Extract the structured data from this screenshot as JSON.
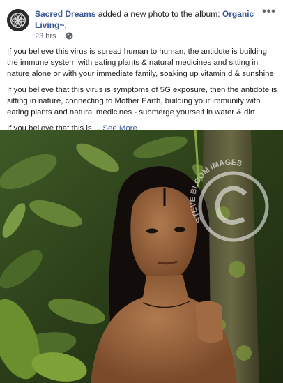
{
  "header": {
    "author": "Sacred Dreams",
    "action": " added a new photo to the album: ",
    "album": "Organic Living~.",
    "timestamp": "23 hrs",
    "separator": "·",
    "privacy_icon": "globe-icon",
    "more_icon": "ellipsis-icon",
    "more_label": "•••"
  },
  "post": {
    "paragraphs": [
      "If you believe this virus is spread human to human, the antidote is building the immune system with eating plants & natural medicines and sitting in nature alone or with your immediate family, soaking up vitamin d & sunshine",
      "If you believe that this virus is symptoms of 5G exposure, then the antidote is sitting in nature, connecting to Mother Earth, building your immunity with eating plants and natural medicines - submerge yourself in water & dirt"
    ],
    "truncated_text": "If you believe that this is ...",
    "see_more": "See More"
  },
  "photo": {
    "watermark_text": "STEVE BLOOM IMAGES",
    "watermark_symbol": "©"
  },
  "colors": {
    "link": "#385898",
    "text": "#1c1e21",
    "meta": "#616770"
  }
}
